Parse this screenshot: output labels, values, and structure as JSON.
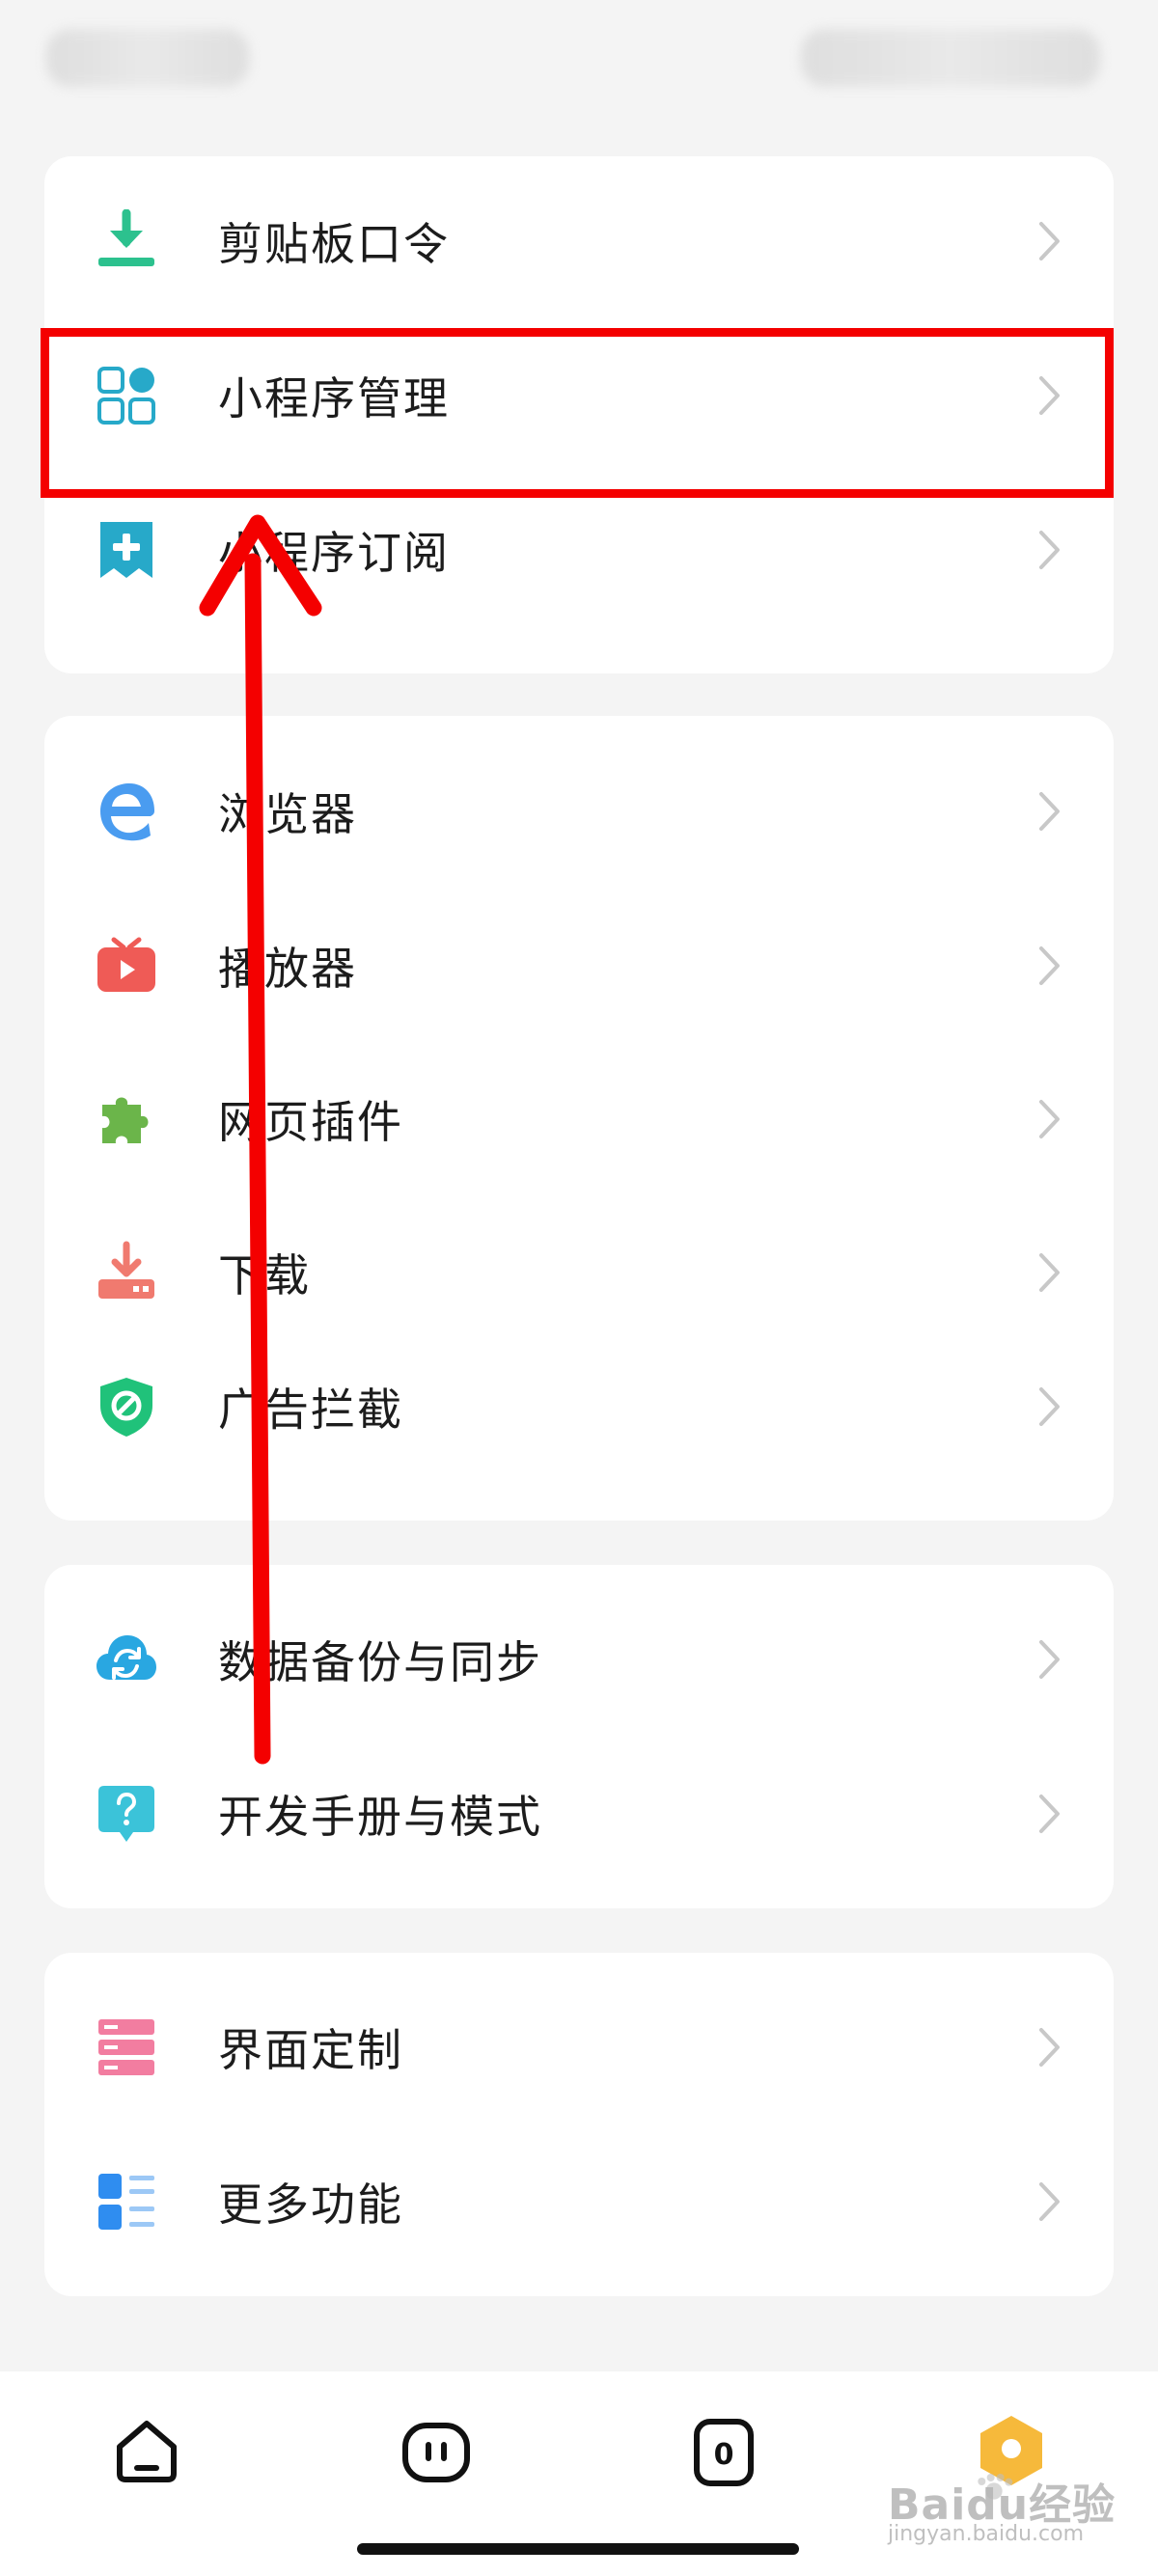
{
  "sections": [
    {
      "items": [
        {
          "label": "剪贴板口令",
          "icon": "clipboard-download-icon",
          "color": "#2cc18e"
        },
        {
          "label": "小程序管理",
          "icon": "mini-program-grid-icon",
          "color": "#27a9c9"
        },
        {
          "label": "小程序订阅",
          "icon": "subscribe-bookmark-icon",
          "color": "#27a9c9"
        }
      ]
    },
    {
      "items": [
        {
          "label": "浏览器",
          "icon": "browser-e-icon",
          "color": "#4a9cf0"
        },
        {
          "label": "播放器",
          "icon": "tv-player-icon",
          "color": "#ef5b56"
        },
        {
          "label": "网页插件",
          "icon": "puzzle-plugin-icon",
          "color": "#6bb54a"
        },
        {
          "label": "下载",
          "icon": "download-tray-icon",
          "color": "#f07a6f"
        },
        {
          "label": "广告拦截",
          "icon": "ad-block-shield-icon",
          "color": "#20c27a"
        }
      ]
    },
    {
      "items": [
        {
          "label": "数据备份与同步",
          "icon": "cloud-sync-icon",
          "color": "#29a7e1"
        },
        {
          "label": "开发手册与模式",
          "icon": "help-bubble-icon",
          "color": "#3bc3d9"
        }
      ]
    },
    {
      "items": [
        {
          "label": "界面定制",
          "icon": "layout-list-icon",
          "color": "#f27da0"
        },
        {
          "label": "更多功能",
          "icon": "more-features-icon",
          "color": "#2f8df0"
        }
      ]
    }
  ],
  "bottom_nav": {
    "tab_count": "0"
  },
  "watermark": {
    "main": "Baidu经验",
    "sub": "jingyan.baidu.com"
  },
  "annotation": {
    "highlight_color": "#f40000"
  }
}
